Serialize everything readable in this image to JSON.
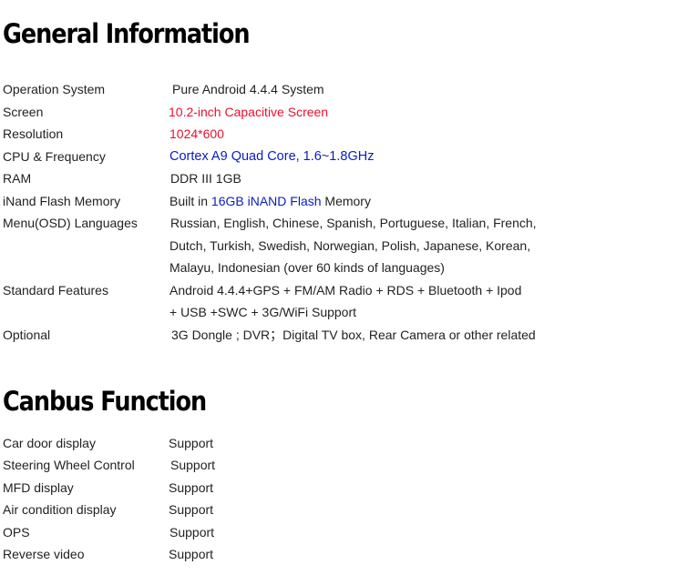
{
  "general": {
    "title": "General Information",
    "rows": [
      {
        "label": "Operation System",
        "value": "Pure Android 4.4.4 System"
      },
      {
        "label": "Screen",
        "value": "10.2-inch Capacitive Screen"
      },
      {
        "label": "Resolution",
        "value": "1024*600"
      },
      {
        "label": "CPU & Frequency",
        "value": "Cortex A9 Quad Core, 1.6~1.8GHz"
      },
      {
        "label": "RAM",
        "value": "DDR III 1GB"
      },
      {
        "label": "iNand Flash Memory",
        "value_pre": "Built in ",
        "value_highlight": "16GB iNAND Flash",
        "value_post": " Memory"
      },
      {
        "label": "Menu(OSD) Languages",
        "value_lines": [
          "Russian, English, Chinese, Spanish, Portuguese, Italian, French,",
          "Dutch, Turkish, Swedish, Norwegian, Polish, Japanese, Korean,",
          "Malayu, Indonesian (over 60 kinds of languages)"
        ]
      },
      {
        "label": "Standard Features",
        "value_lines": [
          "Android 4.4.4+GPS + FM/AM Radio + RDS + Bluetooth + Ipod",
          "+  USB +SWC + 3G/WiFi Support"
        ]
      },
      {
        "label": "Optional",
        "value": "3G Dongle ; DVR；Digital TV box, Rear Camera or other related"
      }
    ]
  },
  "canbus": {
    "title": "Canbus Function",
    "rows": [
      {
        "label": "Car door display",
        "value": "Support"
      },
      {
        "label": "Steering Wheel Control",
        "value": "Support"
      },
      {
        "label": "MFD display",
        "value": "Support"
      },
      {
        "label": "Air condition display",
        "value": "Support"
      },
      {
        "label": "OPS",
        "value": "Support"
      },
      {
        "label": "Reverse video",
        "value": "Support"
      }
    ]
  },
  "colors": {
    "highlight_red": "#e8112d",
    "highlight_blue": "#0a1dbf",
    "text": "#222222"
  }
}
